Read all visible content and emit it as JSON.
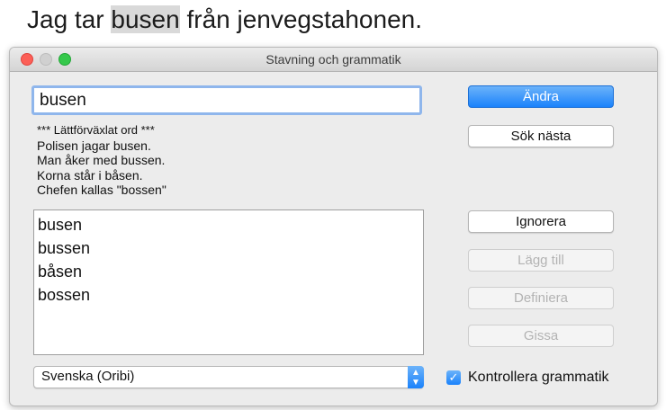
{
  "document": {
    "before": "Jag tar ",
    "highlighted_word": "busen",
    "after": " från jenvegstahonen."
  },
  "window": {
    "title": "Stavning och grammatik"
  },
  "word_field": {
    "value": "busen"
  },
  "description": {
    "lines": [
      "*** Lättförväxlat ord ***",
      "Polisen jagar busen.",
      "Man åker med bussen.",
      "Korna står i båsen.",
      "Chefen kallas \"bossen\""
    ]
  },
  "suggestions": [
    "busen",
    "bussen",
    "båsen",
    "bossen"
  ],
  "buttons": {
    "change": "Ändra",
    "find_next": "Sök nästa",
    "ignore": "Ignorera",
    "learn": "Lägg till",
    "define": "Definiera",
    "guess": "Gissa"
  },
  "language_select": {
    "value": "Svenska (Oribi)"
  },
  "grammar_checkbox": {
    "label": "Kontrollera grammatik",
    "checked": true
  }
}
